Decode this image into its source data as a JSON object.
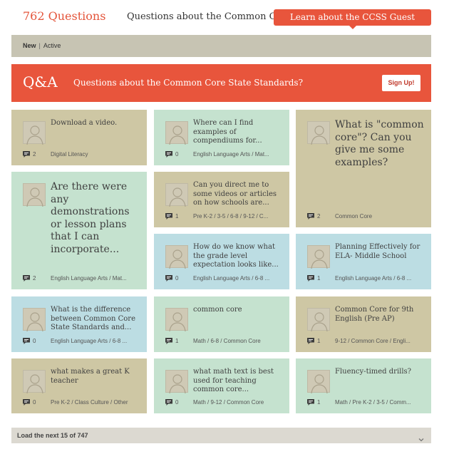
{
  "header": {
    "count": "762 Questions",
    "question": "Questions about the Common Core?",
    "cta": "Learn about the CCSS Guest Experts"
  },
  "filters": {
    "new": "New",
    "separator": "|",
    "active": "Active"
  },
  "banner": {
    "logo": "Q&A",
    "title": "Questions about the Common Core State Standards?",
    "signup": "Sign Up!"
  },
  "cards": [
    {
      "question": "Download a video.",
      "count": "2",
      "tags": "Digital Literacy"
    },
    {
      "question": "Are there were any demonstrations or lesson plans that I can incorporate...",
      "count": "2",
      "tags": "English Language Arts / Mat..."
    },
    {
      "question": "What is the difference between Common Core State Standards and...",
      "count": "0",
      "tags": "English Language Arts / 6-8 ..."
    },
    {
      "question": "what makes a great K teacher",
      "count": "0",
      "tags": "Pre K-2 / Class Culture / Other"
    },
    {
      "question": "Where can I find examples of compendiums for...",
      "count": "0",
      "tags": "English Language Arts / Mat..."
    },
    {
      "question": "Can you direct me to some videos or articles on how schools are...",
      "count": "1",
      "tags": "Pre K-2 / 3-5 / 6-8 / 9-12 / C..."
    },
    {
      "question": "How do we know what the grade level expectation looks like...",
      "count": "0",
      "tags": "English Language Arts / 6-8 ..."
    },
    {
      "question": "common core",
      "count": "1",
      "tags": "Math / 6-8 / Common Core"
    },
    {
      "question": "what math text is best used for teaching common core...",
      "count": "0",
      "tags": "Math / 9-12 / Common Core"
    },
    {
      "question": "What is \"common core\"? Can you give me some examples?",
      "count": "2",
      "tags": "Common Core"
    },
    {
      "question": "Planning Effectively for ELA- Middle School",
      "count": "1",
      "tags": "English Language Arts / 6-8 ..."
    },
    {
      "question": "Common Core for 9th English (Pre AP)",
      "count": "1",
      "tags": "9-12 / Common Core / Engli..."
    },
    {
      "question": "Fluency-timed drills?",
      "count": "1",
      "tags": "Math / Pre K-2 / 3-5 / Comm..."
    }
  ],
  "load_more": "Load the next 15 of 747",
  "colors": {
    "accent": "#e8553c",
    "tan": "#cec7a4",
    "mint": "#c5e2cf",
    "blue": "#bcdde3",
    "filterbar": "#c7c4b3"
  },
  "icons": {
    "comment": "comment-bubble-icon",
    "avatar": "user-silhouette-icon",
    "expand": "chevron-down-icon"
  }
}
